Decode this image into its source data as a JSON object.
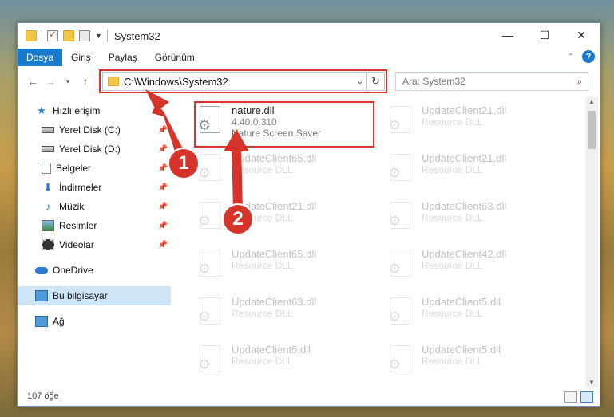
{
  "window": {
    "title": "System32"
  },
  "ribbon": {
    "tabs": [
      {
        "label": "Dosya",
        "active": true
      },
      {
        "label": "Giriş"
      },
      {
        "label": "Paylaş"
      },
      {
        "label": "Görünüm"
      }
    ]
  },
  "address": {
    "path": "C:\\Windows\\System32"
  },
  "search": {
    "placeholder": "Ara: System32"
  },
  "sidebar": {
    "items": [
      {
        "label": "Hızlı erişim",
        "icon": "star-icon"
      },
      {
        "label": "Yerel Disk (C:)",
        "icon": "disk-icon",
        "pinned": true
      },
      {
        "label": "Yerel Disk (D:)",
        "icon": "disk-icon",
        "pinned": true
      },
      {
        "label": "Belgeler",
        "icon": "document-icon",
        "pinned": true
      },
      {
        "label": "İndirmeler",
        "icon": "download-icon",
        "pinned": true
      },
      {
        "label": "Müzik",
        "icon": "music-icon",
        "pinned": true
      },
      {
        "label": "Resimler",
        "icon": "pictures-icon",
        "pinned": true
      },
      {
        "label": "Videolar",
        "icon": "video-icon",
        "pinned": true
      },
      {
        "label": "OneDrive",
        "icon": "cloud-icon"
      },
      {
        "label": "Bu bilgisayar",
        "icon": "computer-icon",
        "selected": true
      },
      {
        "label": "Ağ",
        "icon": "network-icon"
      }
    ]
  },
  "files": [
    {
      "name": "nature.dll",
      "version": "4.40.0.310",
      "description": "Nature Screen Saver"
    },
    {
      "name": "UpdateClient21.dll",
      "description": "Resource DLL"
    },
    {
      "name": "UpdateClient65.dll",
      "description": "Resource DLL"
    },
    {
      "name": "UpdateClient21.dll",
      "description": "Resource DLL"
    },
    {
      "name": "UpdateClient21.dll",
      "description": "Resource DLL"
    },
    {
      "name": "UpdateClient63.dll",
      "description": "Resource DLL"
    },
    {
      "name": "UpdateClient65.dll",
      "description": "Resource DLL"
    },
    {
      "name": "UpdateClient42.dll",
      "description": "Resource DLL"
    },
    {
      "name": "UpdateClient63.dll",
      "description": "Resource DLL"
    },
    {
      "name": "UpdateClient5.dll",
      "description": "Resource DLL"
    },
    {
      "name": "UpdateClient5.dll",
      "description": "Resource DLL"
    },
    {
      "name": "UpdateClient5.dll",
      "description": "Resource DLL"
    }
  ],
  "status": {
    "count": "107 öğe"
  },
  "annotations": {
    "badge1": "1",
    "badge2": "2"
  },
  "colors": {
    "accent": "#1979ca",
    "highlight": "#d6342b"
  }
}
